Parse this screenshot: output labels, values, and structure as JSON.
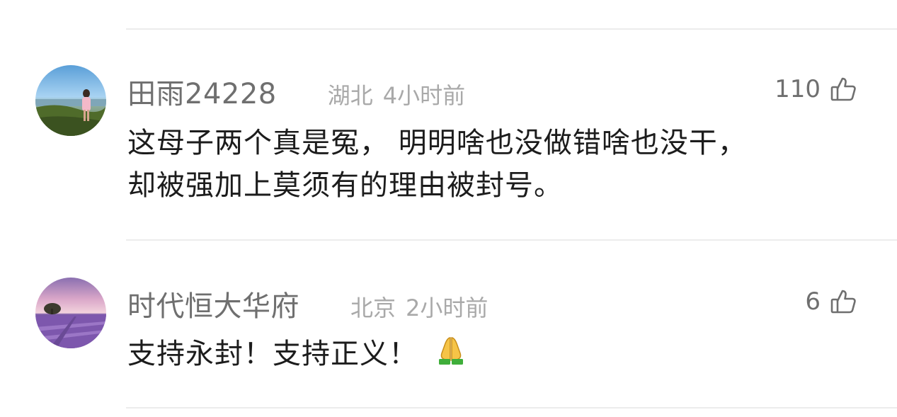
{
  "comments": [
    {
      "username": "田雨24228",
      "location": "湖北",
      "time": "4小时前",
      "likes": "110",
      "text_lines": [
        "这母子两个真是冤， 明明啥也没做错啥也没干，",
        "却被强加上莫须有的理由被封号。"
      ],
      "avatar_icon": "landscape-avatar-icon"
    },
    {
      "username": "时代恒大华府",
      "location": "北京",
      "time": "2小时前",
      "likes": "6",
      "text": "支持永封！支持正义！",
      "emoji_icon": "folded-hands-icon",
      "avatar_icon": "lavender-field-avatar-icon"
    }
  ],
  "colors": {
    "username": "#6f6f6f",
    "meta": "#a9a9a9",
    "text": "#1c1c1c",
    "divider": "#ececec"
  }
}
